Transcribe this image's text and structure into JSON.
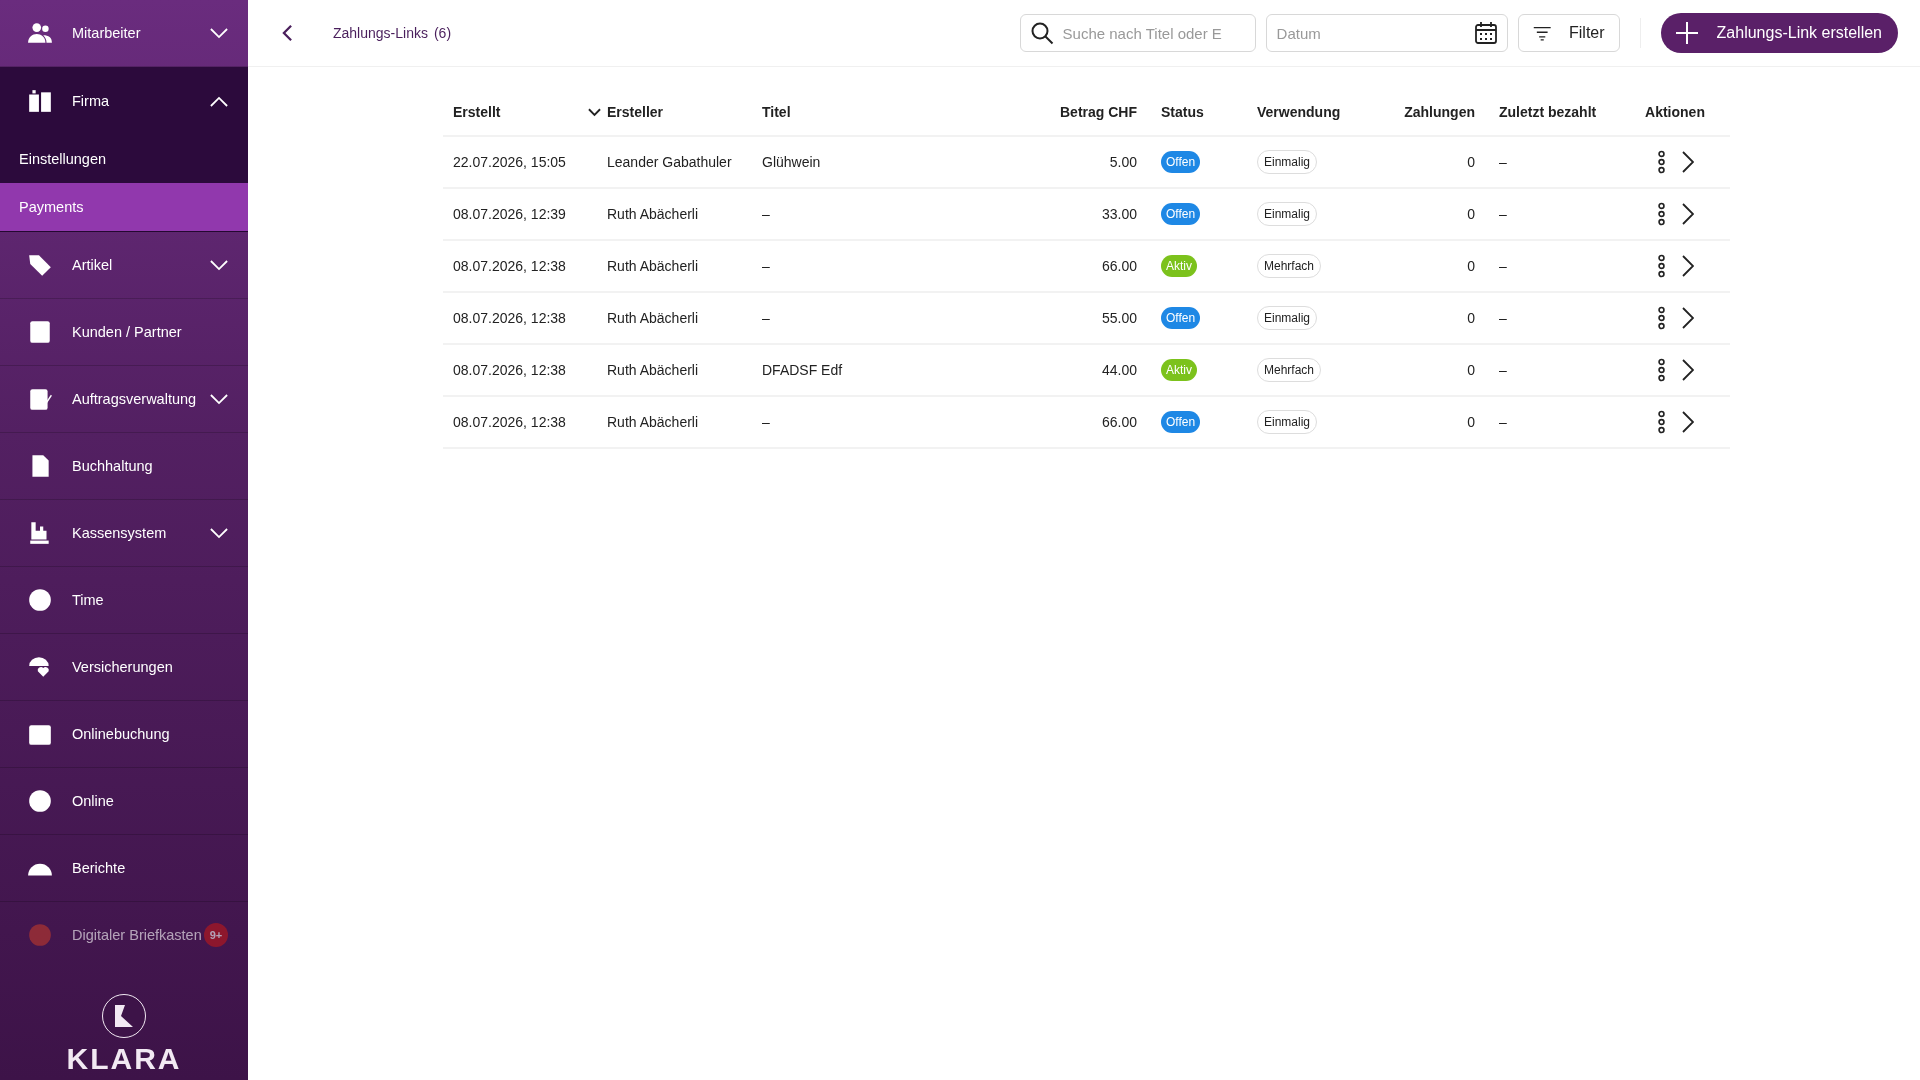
{
  "sidebar": {
    "items": [
      {
        "label": "Mitarbeiter",
        "kind": "group",
        "expanded": false
      },
      {
        "label": "Firma",
        "kind": "group",
        "expanded": true,
        "children": [
          {
            "label": "Einstellungen",
            "selected": false
          },
          {
            "label": "Payments",
            "selected": true
          }
        ]
      },
      {
        "label": "Artikel",
        "kind": "group",
        "expanded": false
      },
      {
        "label": "Kunden / Partner",
        "kind": "link"
      },
      {
        "label": "Auftragsverwaltung",
        "kind": "group",
        "expanded": false
      },
      {
        "label": "Buchhaltung",
        "kind": "link"
      },
      {
        "label": "Kassensystem",
        "kind": "group",
        "expanded": false
      },
      {
        "label": "Time",
        "kind": "link"
      },
      {
        "label": "Versicherungen",
        "kind": "link"
      },
      {
        "label": "Onlinebuchung",
        "kind": "link"
      },
      {
        "label": "Online",
        "kind": "link"
      },
      {
        "label": "Berichte",
        "kind": "link"
      },
      {
        "label": "Digitaler Briefkasten",
        "kind": "link",
        "badge": "9+",
        "faded": true
      }
    ],
    "logo": "KLARA"
  },
  "header": {
    "title": "Zahlungs-Links",
    "count": "(6)",
    "search": {
      "placeholder": "Suche nach Titel oder E"
    },
    "date": {
      "placeholder": "Datum"
    },
    "filter_button": "Filter",
    "create_button": "Zahlungs-Link erstellen"
  },
  "table": {
    "columns": [
      "Erstellt",
      "Ersteller",
      "Titel",
      "Betrag CHF",
      "Status",
      "Verwendung",
      "Zahlungen",
      "Zuletzt bezahlt",
      "Aktionen"
    ],
    "rows": [
      {
        "created": "22.07.2026, 15:05",
        "creator": "Leander Gabathuler",
        "title": "Glühwein",
        "amount": "5.00",
        "status": {
          "label": "Offen",
          "color": "#1e88e5"
        },
        "usage": "Einmalig",
        "payments": "0",
        "last_paid": "–"
      },
      {
        "created": "08.07.2026, 12:39",
        "creator": "Ruth Abächerli",
        "title": "–",
        "amount": "33.00",
        "status": {
          "label": "Offen",
          "color": "#1e88e5"
        },
        "usage": "Einmalig",
        "payments": "0",
        "last_paid": "–"
      },
      {
        "created": "08.07.2026, 12:38",
        "creator": "Ruth Abächerli",
        "title": "–",
        "amount": "66.00",
        "status": {
          "label": "Aktiv",
          "color": "#7cc21c"
        },
        "usage": "Mehrfach",
        "payments": "0",
        "last_paid": "–"
      },
      {
        "created": "08.07.2026, 12:38",
        "creator": "Ruth Abächerli",
        "title": "–",
        "amount": "55.00",
        "status": {
          "label": "Offen",
          "color": "#1e88e5"
        },
        "usage": "Einmalig",
        "payments": "0",
        "last_paid": "–"
      },
      {
        "created": "08.07.2026, 12:38",
        "creator": "Ruth Abächerli",
        "title": "DFADSF Edf",
        "amount": "44.00",
        "status": {
          "label": "Aktiv",
          "color": "#7cc21c"
        },
        "usage": "Mehrfach",
        "payments": "0",
        "last_paid": "–"
      },
      {
        "created": "08.07.2026, 12:38",
        "creator": "Ruth Abächerli",
        "title": "–",
        "amount": "66.00",
        "status": {
          "label": "Offen",
          "color": "#1e88e5"
        },
        "usage": "Einmalig",
        "payments": "0",
        "last_paid": "–"
      }
    ]
  }
}
